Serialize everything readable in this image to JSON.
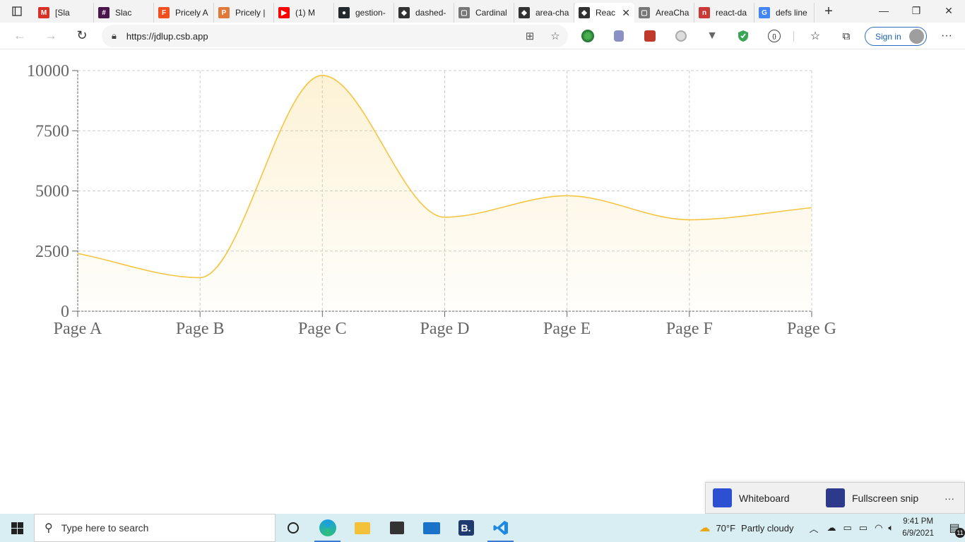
{
  "browser": {
    "tabs": [
      {
        "title": "[Sla",
        "icon": "gmail-icon",
        "color": "#d93025",
        "glyph": "M"
      },
      {
        "title": "Slac",
        "icon": "slack-icon",
        "color": "#4a154b",
        "glyph": "#"
      },
      {
        "title": "Pricely A",
        "icon": "figma-icon",
        "color": "#f24e1e",
        "glyph": "F"
      },
      {
        "title": "Pricely | ",
        "icon": "pricely-icon",
        "color": "#e07a3a",
        "glyph": "P"
      },
      {
        "title": "(1) M",
        "icon": "youtube-icon",
        "color": "#ff0000",
        "glyph": "▶"
      },
      {
        "title": "gestion-",
        "icon": "github-icon",
        "color": "#24292e",
        "glyph": "●"
      },
      {
        "title": "dashed-",
        "icon": "codesandbox-icon",
        "color": "#333333",
        "glyph": "◆"
      },
      {
        "title": "Cardinal",
        "icon": "page-icon",
        "color": "#777777",
        "glyph": "▢"
      },
      {
        "title": "area-cha",
        "icon": "codesandbox-icon",
        "color": "#333333",
        "glyph": "◆"
      },
      {
        "title": "Reac",
        "icon": "codesandbox-icon",
        "color": "#333333",
        "glyph": "◆",
        "active": true
      },
      {
        "title": "AreaCha",
        "icon": "page-icon",
        "color": "#777777",
        "glyph": "▢"
      },
      {
        "title": "react-da",
        "icon": "npm-icon",
        "color": "#cb3837",
        "glyph": "n"
      },
      {
        "title": "defs line",
        "icon": "google-icon",
        "color": "#4285f4",
        "glyph": "G"
      }
    ],
    "url": "https://jdlup.csb.app",
    "sign_in": "Sign in"
  },
  "chart_data": {
    "type": "area",
    "categories": [
      "Page A",
      "Page B",
      "Page C",
      "Page D",
      "Page E",
      "Page F",
      "Page G"
    ],
    "series": [
      {
        "values": [
          2400,
          1398,
          9800,
          3908,
          4800,
          3800,
          4300
        ],
        "color": "#f5c542"
      }
    ],
    "yticks": [
      0,
      2500,
      5000,
      7500,
      10000
    ],
    "ylim": [
      0,
      10000
    ],
    "grid": true,
    "grid_style": "dashed",
    "curve": "monotone"
  },
  "snip_bar": {
    "whiteboard": "Whiteboard",
    "fullscreen_snip": "Fullscreen snip",
    "more": "···"
  },
  "taskbar": {
    "search_placeholder": "Type here to search",
    "weather_temp": "70°F",
    "weather_desc": "Partly cloudy",
    "time": "9:41 PM",
    "date": "6/9/2021",
    "notification_count": "11"
  }
}
